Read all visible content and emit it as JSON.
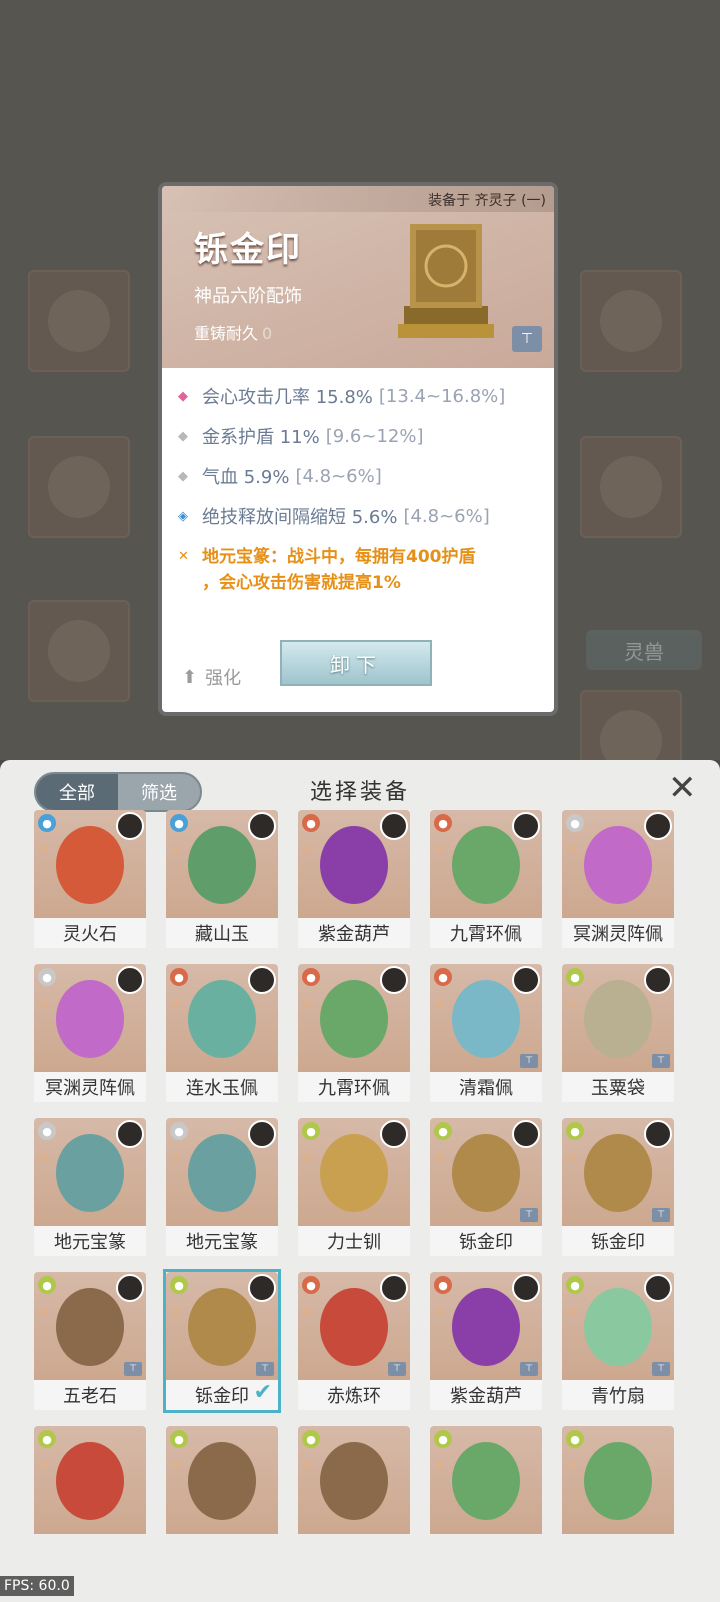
{
  "background": {
    "spirit_beast_label": "灵兽",
    "dim_slots": 6
  },
  "detail": {
    "equipped_on": "装备于 齐灵子 (一)",
    "name": "铄金印",
    "grade": "神品六阶配饰",
    "recast_label": "重铸耐久",
    "recast_value": "0",
    "stats": [
      {
        "glyph": "◆",
        "glyph_color": "#e0649a",
        "text": "会心攻击几率 15.8%",
        "range": "[13.4~16.8%]"
      },
      {
        "glyph": "◆",
        "glyph_color": "#b8b8b8",
        "text": "金系护盾 11%",
        "range": "[9.6~12%]"
      },
      {
        "glyph": "◆",
        "glyph_color": "#b8b8b8",
        "text": "气血 5.9%",
        "range": "[4.8~6%]"
      },
      {
        "glyph": "◈",
        "glyph_color": "#3a8fd6",
        "text": "绝技释放间隔缩短 5.6%",
        "range": "[4.8~6%]"
      }
    ],
    "special_line1": "地元宝篆：战斗中，每拥有400护盾",
    "special_line2": "，会心攻击伤害就提高1%",
    "unequip_label": "卸下",
    "upgrade_label": "强化"
  },
  "panel": {
    "title": "选择装备",
    "filter_all": "全部",
    "filter_select": "筛选",
    "items": [
      {
        "label": "灵火石",
        "el": "#4aa0d8",
        "art": "#d45a3a",
        "lock": false
      },
      {
        "label": "藏山玉",
        "el": "#4aa0d8",
        "art": "#5f9e6a",
        "lock": false
      },
      {
        "label": "紫金葫芦",
        "el": "#d86a4a",
        "art": "#8a3fa8",
        "lock": false
      },
      {
        "label": "九霄环佩",
        "el": "#d86a4a",
        "art": "#6aa86a",
        "lock": false
      },
      {
        "label": "冥渊灵阵佩",
        "el": "#c8c8c8",
        "art": "#c26ac8",
        "lock": false
      },
      {
        "label": "冥渊灵阵佩",
        "el": "#c8c8c8",
        "art": "#c26ac8",
        "lock": false
      },
      {
        "label": "连水玉佩",
        "el": "#d86a4a",
        "art": "#6ab0a0",
        "lock": false
      },
      {
        "label": "九霄环佩",
        "el": "#d86a4a",
        "art": "#6aa86a",
        "lock": false
      },
      {
        "label": "清霜佩",
        "el": "#d86a4a",
        "art": "#7ab8c8",
        "lock": true
      },
      {
        "label": "玉粟袋",
        "el": "#b0c84a",
        "art": "#b8b090",
        "lock": true
      },
      {
        "label": "地元宝篆",
        "el": "#c8c8c8",
        "art": "#6aa0a0",
        "lock": false
      },
      {
        "label": "地元宝篆",
        "el": "#c8c8c8",
        "art": "#6aa0a0",
        "lock": false
      },
      {
        "label": "力士钏",
        "el": "#b0c84a",
        "art": "#c8a050",
        "lock": false
      },
      {
        "label": "铄金印",
        "el": "#b0c84a",
        "art": "#b08a4a",
        "lock": true
      },
      {
        "label": "铄金印",
        "el": "#b0c84a",
        "art": "#b08a4a",
        "lock": true
      },
      {
        "label": "五老石",
        "el": "#b0c84a",
        "art": "#8a6a4a",
        "lock": true
      },
      {
        "label": "铄金印",
        "el": "#b0c84a",
        "art": "#b08a4a",
        "lock": true,
        "selected": true
      },
      {
        "label": "赤炼环",
        "el": "#d86a4a",
        "art": "#c84a3a",
        "lock": true
      },
      {
        "label": "紫金葫芦",
        "el": "#d86a4a",
        "art": "#8a3fa8",
        "lock": true
      },
      {
        "label": "青竹扇",
        "el": "#b0c84a",
        "art": "#8ac8a0",
        "lock": true
      },
      {
        "label": "",
        "el": "#b0c84a",
        "art": "#c84a3a",
        "lock": false
      },
      {
        "label": "",
        "el": "#b0c84a",
        "art": "#8a6a4a",
        "lock": false
      },
      {
        "label": "",
        "el": "#b0c84a",
        "art": "#8a6a4a",
        "lock": false
      },
      {
        "label": "",
        "el": "#b0c84a",
        "art": "#6aa86a",
        "lock": false
      },
      {
        "label": "",
        "el": "#b0c84a",
        "art": "#6aa86a",
        "lock": false
      }
    ]
  },
  "fps": "FPS: 60.0"
}
